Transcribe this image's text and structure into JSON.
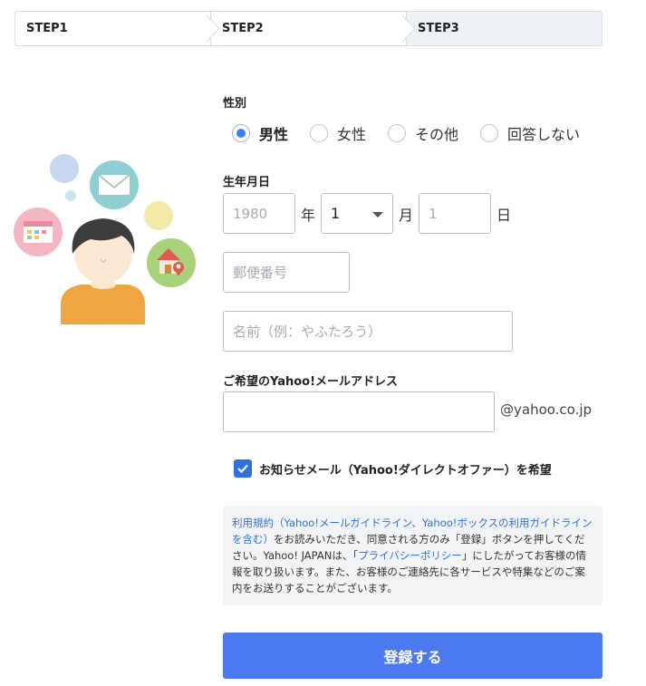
{
  "steps": [
    "STEP1",
    "STEP2",
    "STEP3"
  ],
  "active_step": 3,
  "gender": {
    "label": "性別",
    "options": [
      "男性",
      "女性",
      "その他",
      "回答しない"
    ],
    "selected": "男性"
  },
  "birthdate": {
    "label": "生年月日",
    "year_placeholder": "1980",
    "year_unit": "年",
    "month_value": "1",
    "month_unit": "月",
    "day_placeholder": "1",
    "day_unit": "日"
  },
  "postal": {
    "placeholder": "郵便番号"
  },
  "name": {
    "placeholder": "名前（例：やふたろう）"
  },
  "email": {
    "label": "ご希望のYahoo!メールアドレス",
    "value": "",
    "domain": "@yahoo.co.jp"
  },
  "newsletter": {
    "checked": true,
    "label": "お知らせメール（Yahoo!ダイレクトオファー）を希望"
  },
  "terms": {
    "link_terms": "利用規約（Yahoo!メールガイドライン、Yahoo!ボックスの利用ガイドラインを含む）",
    "text1": "をお読みいただき、同意される方のみ「登録」ボタンを押してください。Yahoo! JAPANは、「",
    "link_privacy": "プライバシーポリシー",
    "text2": "」にしたがってお客様の情報を取り扱います。また、お客様のご連絡先に各サービスや特集などのご案内をお送りすることがございます。"
  },
  "submit_label": "登録する",
  "colors": {
    "accent": "#4b79f0",
    "link": "#2f6fde",
    "radio_selected": "#3b82f6",
    "step_active_bg": "#eef1f5"
  }
}
